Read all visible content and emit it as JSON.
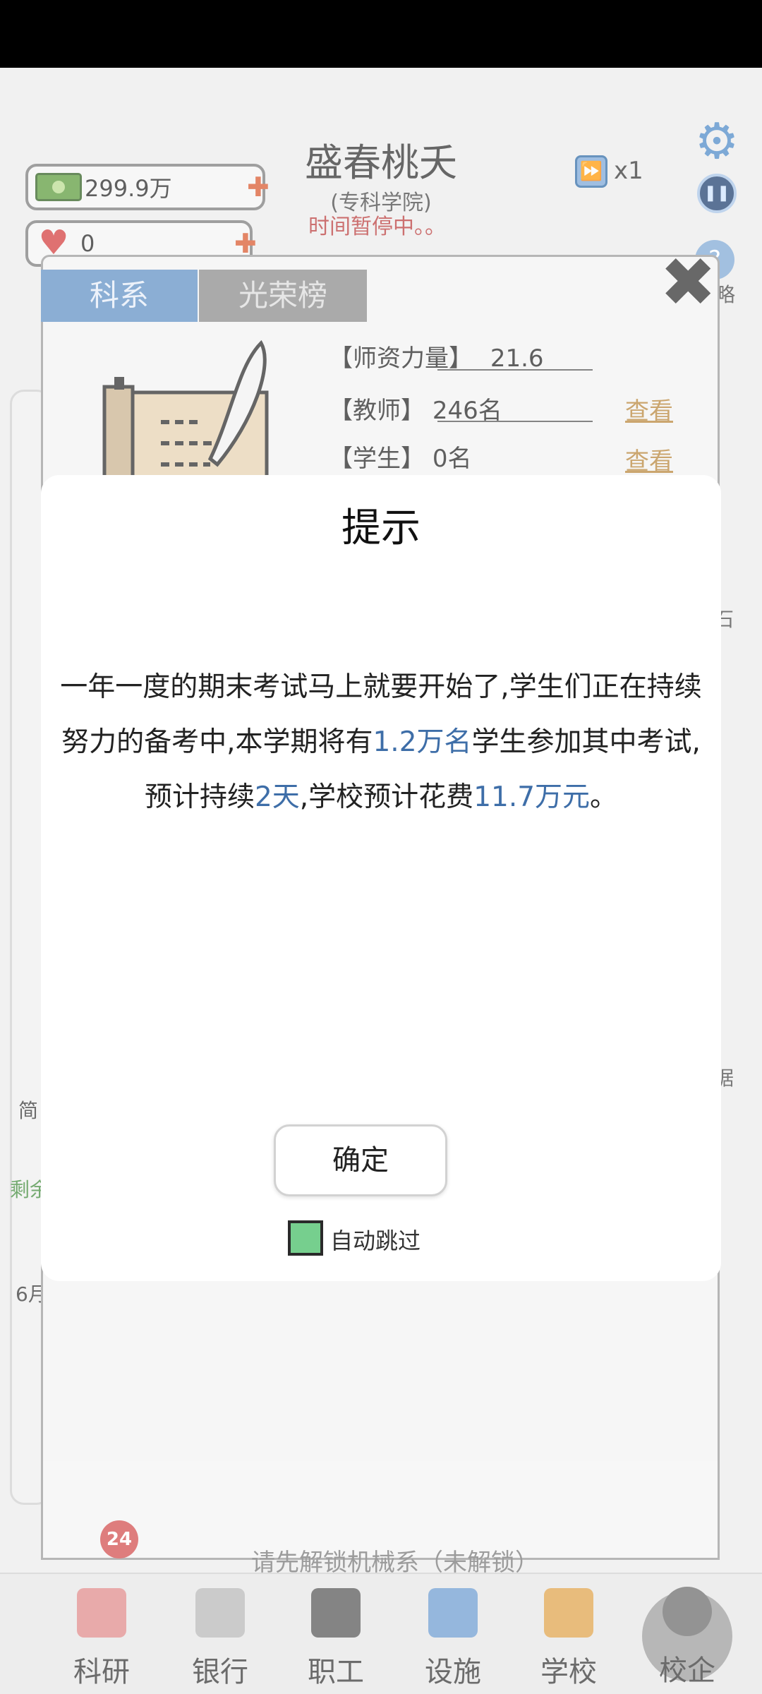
{
  "hud": {
    "money": "299.9万",
    "hearts": "0",
    "school_name": "盛春桃夭",
    "school_type": "(专科学院)",
    "paused_status": "时间暂停中。。",
    "speed": "x1",
    "help_label": "略"
  },
  "panel": {
    "tabs": [
      "科系",
      "光荣榜"
    ],
    "stats": {
      "faculty_label": "【师资力量】",
      "faculty_value": "21.6",
      "teachers_label": "【教师】",
      "teachers_value": "246名",
      "students_label": "【学生】",
      "students_value": "0名",
      "view_label": "查看"
    },
    "unlock_badge": "24",
    "unlock_text": "请先解锁机械系（未解锁）"
  },
  "left_fragments": {
    "jian": "简",
    "sheng": "剩余",
    "month": "6月"
  },
  "right_fragments": {
    "shi": "石",
    "ju": "据"
  },
  "modal": {
    "title": "提示",
    "message_parts": {
      "p1": "一年一度的期末考试马上就要开始了,学生们正在持续努力的备考中,本学期将有",
      "students": "1.2万名",
      "p2": "学生参加其中考试,预计持续",
      "days": "2天",
      "p3": ",学校预计花费",
      "cost": "11.7万元",
      "p4": "。"
    },
    "confirm": "确定",
    "auto_skip": "自动跳过",
    "auto_skip_checked": true
  },
  "nav": [
    "科研",
    "银行",
    "职工",
    "设施",
    "学校",
    "校企"
  ],
  "colors": {
    "tab_active": "#5f8fc4",
    "highlight": "#3e6ea8",
    "paused_text": "#b93a3a",
    "checkbox": "#76cf8e"
  }
}
